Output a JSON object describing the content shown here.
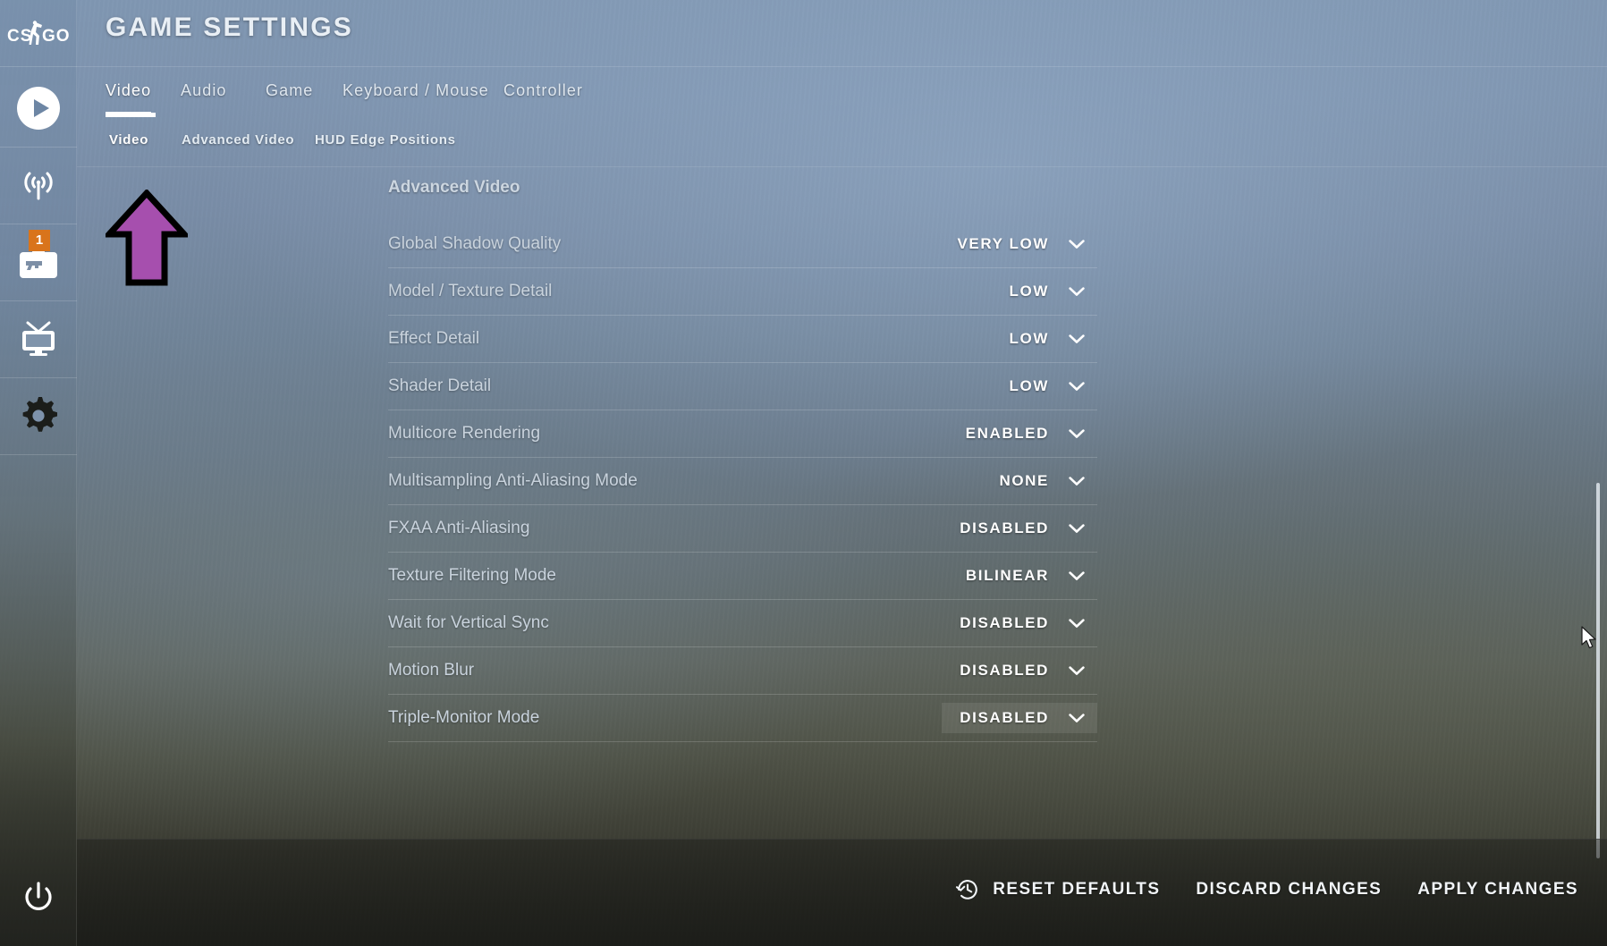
{
  "app": {
    "logo_text": "CS:GO",
    "title": "GAME SETTINGS"
  },
  "sidebar": {
    "items": [
      {
        "name": "play",
        "icon": "play-circle-icon",
        "badge": null
      },
      {
        "name": "watch-broadcast",
        "icon": "broadcast-antenna-icon",
        "badge": null
      },
      {
        "name": "inventory",
        "icon": "weapon-case-icon",
        "badge": "1"
      },
      {
        "name": "watch",
        "icon": "television-icon",
        "badge": null
      },
      {
        "name": "settings",
        "icon": "gear-icon",
        "badge": null
      }
    ],
    "power": {
      "icon": "power-icon"
    }
  },
  "tabs": [
    {
      "label": "Video",
      "active": true
    },
    {
      "label": "Audio",
      "active": false
    },
    {
      "label": "Game",
      "active": false
    },
    {
      "label": "Keyboard / Mouse",
      "active": false
    },
    {
      "label": "Controller",
      "active": false
    }
  ],
  "subtabs": [
    {
      "label": "Video",
      "active": true
    },
    {
      "label": "Advanced Video",
      "active": false
    },
    {
      "label": "HUD Edge Positions",
      "active": false
    }
  ],
  "section": {
    "title": "Advanced Video"
  },
  "settings": [
    {
      "label": "Global Shadow Quality",
      "value": "VERY LOW",
      "highlighted": false
    },
    {
      "label": "Model / Texture Detail",
      "value": "LOW",
      "highlighted": false
    },
    {
      "label": "Effect Detail",
      "value": "LOW",
      "highlighted": false
    },
    {
      "label": "Shader Detail",
      "value": "LOW",
      "highlighted": false
    },
    {
      "label": "Multicore Rendering",
      "value": "ENABLED",
      "highlighted": false
    },
    {
      "label": "Multisampling Anti-Aliasing Mode",
      "value": "NONE",
      "highlighted": false
    },
    {
      "label": "FXAA Anti-Aliasing",
      "value": "DISABLED",
      "highlighted": false
    },
    {
      "label": "Texture Filtering Mode",
      "value": "BILINEAR",
      "highlighted": false
    },
    {
      "label": "Wait for Vertical Sync",
      "value": "DISABLED",
      "highlighted": false
    },
    {
      "label": "Motion Blur",
      "value": "DISABLED",
      "highlighted": false
    },
    {
      "label": "Triple-Monitor Mode",
      "value": "DISABLED",
      "highlighted": true
    }
  ],
  "footer": {
    "reset_label": "RESET DEFAULTS",
    "reset_icon": "history-clock-icon",
    "discard_label": "DISCARD CHANGES",
    "apply_label": "APPLY CHANGES"
  },
  "annotation": {
    "arrow_color": "#a64fae",
    "arrow_outline": "#000000",
    "points_at": "Video"
  },
  "colors": {
    "accent_badge": "#d9741b",
    "tab_underline": "#ffffff",
    "text_primary": "#ffffff",
    "text_label": "#c9d3dd"
  }
}
